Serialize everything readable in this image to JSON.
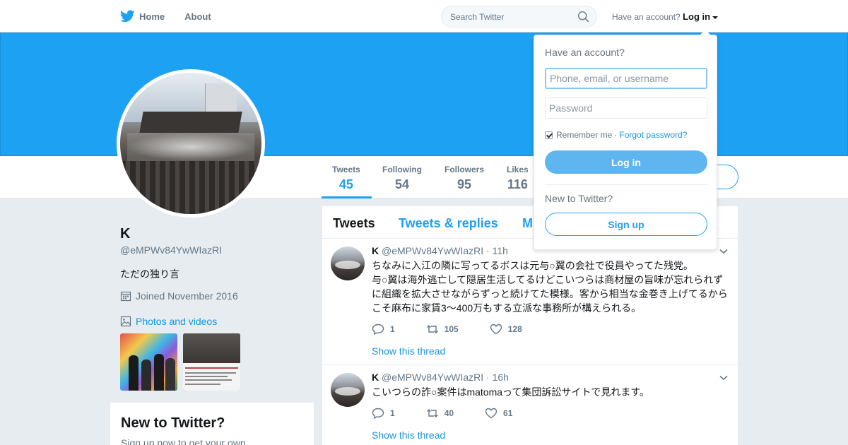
{
  "nav": {
    "home_label": "Home",
    "about_label": "About",
    "search_placeholder": "Search Twitter",
    "have_account_text": "Have an account?",
    "login_label": "Log in"
  },
  "profile": {
    "name": "K",
    "handle": "@eMPWv84YwWIazRI",
    "bio": "ただの独り言",
    "joined": "Joined November 2016",
    "photos_label": "Photos and videos"
  },
  "stats": [
    {
      "label": "Tweets",
      "value": "45"
    },
    {
      "label": "Following",
      "value": "54"
    },
    {
      "label": "Followers",
      "value": "95"
    },
    {
      "label": "Likes",
      "value": "116"
    }
  ],
  "new_card": {
    "title": "New to Twitter?",
    "text": "Sign up now to get your own"
  },
  "tabs": [
    {
      "label": "Tweets"
    },
    {
      "label": "Tweets & replies"
    },
    {
      "label": "M"
    }
  ],
  "tweets": [
    {
      "name": "K",
      "handle": "@eMPWv84YwWIazRI",
      "time": "· 11h",
      "text_lines": [
        "ちなみに入江の隣に写ってるボスは元与○翼の会社で役員やってた残党。",
        "与○翼は海外逃亡して隠居生活してるけどこいつらは商材屋の旨味が忘れられず",
        "に組織を拡大させながらずっと続けてた模様。客から相当な金巻き上げてるから",
        "こそ麻布に家賃3〜400万もする立派な事務所が構えられる。"
      ],
      "replies": "1",
      "retweets": "105",
      "likes": "128",
      "thread_label": "Show this thread"
    },
    {
      "name": "K",
      "handle": "@eMPWv84YwWIazRI",
      "time": "· 16h",
      "text_lines": [
        "こいつらの詐○案件はmatomaって集団訴訟サイトで見れます。"
      ],
      "replies": "1",
      "retweets": "40",
      "likes": "61",
      "thread_label": "Show this thread"
    }
  ],
  "login_dropdown": {
    "title": "Have an account?",
    "username_placeholder": "Phone, email, or username",
    "password_placeholder": "Password",
    "remember_label": "Remember me",
    "separator": "·",
    "forgot_label": "Forgot password?",
    "login_button": "Log in",
    "new_text": "New to Twitter?",
    "signup_button": "Sign up"
  },
  "colors": {
    "brand": "#1da1f2",
    "link": "#1b95e0"
  }
}
